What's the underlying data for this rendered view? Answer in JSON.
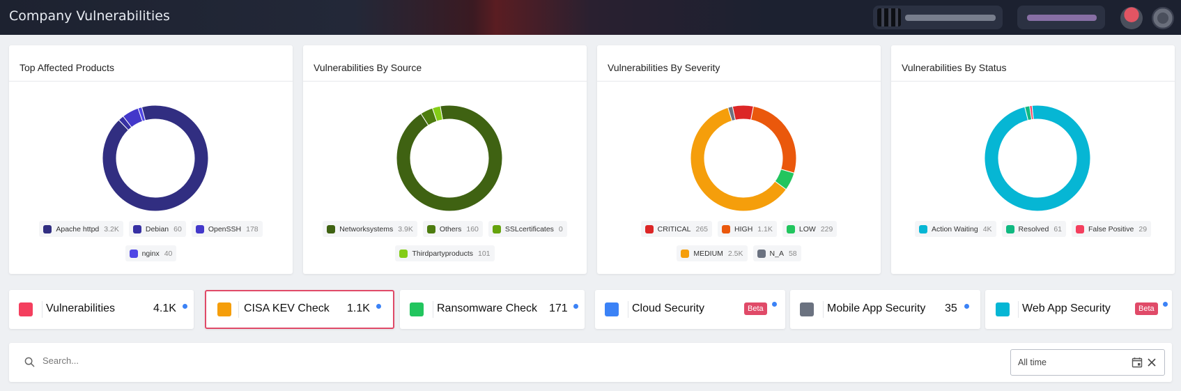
{
  "header": {
    "title": "Company Vulnerabilities"
  },
  "charts_row": [
    {
      "title": "Top Affected Products",
      "legend": [
        {
          "label": "Apache httpd",
          "value": "3.2K",
          "color": "#312e81"
        },
        {
          "label": "Debian",
          "value": "60",
          "color": "#3730a3"
        },
        {
          "label": "OpenSSH",
          "value": "178",
          "color": "#4338ca"
        },
        {
          "label": "nginx",
          "value": "40",
          "color": "#4f46e5"
        }
      ]
    },
    {
      "title": "Vulnerabilities By Source",
      "legend": [
        {
          "label": "Networksystems",
          "value": "3.9K",
          "color": "#3f6212"
        },
        {
          "label": "Others",
          "value": "160",
          "color": "#4d7c0f"
        },
        {
          "label": "SSLcertificates",
          "value": "0",
          "color": "#65a30d"
        },
        {
          "label": "Thirdpartyproducts",
          "value": "101",
          "color": "#84cc16"
        }
      ]
    },
    {
      "title": "Vulnerabilities By Severity",
      "legend": [
        {
          "label": "CRITICAL",
          "value": "265",
          "color": "#dc2626"
        },
        {
          "label": "HIGH",
          "value": "1.1K",
          "color": "#ea580c"
        },
        {
          "label": "LOW",
          "value": "229",
          "color": "#22c55e"
        },
        {
          "label": "MEDIUM",
          "value": "2.5K",
          "color": "#f59e0b"
        },
        {
          "label": "N_A",
          "value": "58",
          "color": "#6b7280"
        }
      ]
    },
    {
      "title": "Vulnerabilities By Status",
      "legend": [
        {
          "label": "Action Waiting",
          "value": "4K",
          "color": "#06b6d4"
        },
        {
          "label": "Resolved",
          "value": "61",
          "color": "#10b981"
        },
        {
          "label": "False Positive",
          "value": "29",
          "color": "#f43f5e"
        }
      ]
    }
  ],
  "chart_data": [
    {
      "type": "pie",
      "categories": [
        "Apache httpd",
        "Debian",
        "OpenSSH",
        "nginx"
      ],
      "values": [
        3200,
        60,
        178,
        40
      ]
    },
    {
      "type": "pie",
      "categories": [
        "Networksystems",
        "Others",
        "SSLcertificates",
        "Thirdpartyproducts"
      ],
      "values": [
        3900,
        160,
        0,
        101
      ]
    },
    {
      "type": "pie",
      "categories": [
        "CRITICAL",
        "HIGH",
        "LOW",
        "MEDIUM",
        "N_A"
      ],
      "values": [
        265,
        1100,
        229,
        2500,
        58
      ]
    },
    {
      "type": "pie",
      "categories": [
        "Action Waiting",
        "Resolved",
        "False Positive"
      ],
      "values": [
        4000,
        61,
        29
      ]
    }
  ],
  "stats": [
    {
      "label": "Vulnerabilities",
      "value": "4.1K",
      "color": "#f43f5e"
    },
    {
      "label": "CISA KEV Check",
      "value": "1.1K",
      "color": "#f59e0b"
    },
    {
      "label": "Ransomware Check",
      "value": "171",
      "color": "#22c55e"
    },
    {
      "label": "Cloud Security",
      "badge": "Beta",
      "color": "#3b82f6"
    },
    {
      "label": "Mobile App Security",
      "value": "35",
      "color": "#6b7280"
    },
    {
      "label": "Web App Security",
      "badge": "Beta",
      "color": "#06b6d4"
    }
  ],
  "search": {
    "placeholder": "Search...",
    "date_range": "All time"
  }
}
